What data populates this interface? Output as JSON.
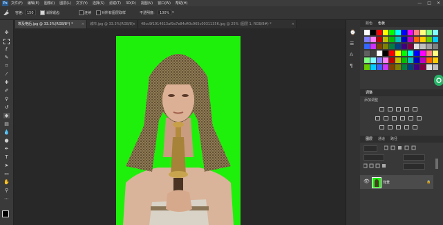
{
  "menu": {
    "logo": "Ps",
    "items": [
      "文件(F)",
      "编辑(E)",
      "图像(I)",
      "图层(L)",
      "文字(Y)",
      "选择(S)",
      "滤镜(T)",
      "3D(D)",
      "视图(V)",
      "窗口(W)",
      "帮助(H)"
    ],
    "controls": [
      "—",
      "□",
      "✕"
    ]
  },
  "options": {
    "tolerance_label": "容差:",
    "tolerance_value": "150",
    "antialias_label": "消除锯齿",
    "contiguous_label": "连续",
    "all_layers_label": "对所有图层取样",
    "opacity_label": "不透明度:",
    "opacity_value": "100%"
  },
  "tabs": [
    {
      "label": "埃及艳后.jpg @ 33.3%(RGB/8*) *",
      "close": "×"
    },
    {
      "label": "城市.jpg @ 33.3%(RGB/8)",
      "close": "×"
    },
    {
      "label": "48cc9f1914613af9a7e84d40c965c00311356.jpg @ 25% (图层 1, RGB/8#) *",
      "close": "×"
    }
  ],
  "panels": {
    "swatch_tabs": [
      "颜色",
      "色板"
    ],
    "adjust_tab": "调整",
    "adjust_label": "添加调整",
    "layers_tabs": [
      "图层",
      "通道",
      "路径"
    ],
    "layer_name": "背景",
    "swatch_colors": [
      "#ffffff",
      "#000000",
      "#ff0000",
      "#ffff00",
      "#00ff00",
      "#00ffff",
      "#0000ff",
      "#ff00ff",
      "#ff8080",
      "#ffff80",
      "#80ff80",
      "#80ffff",
      "#8080ff",
      "#ff80ff",
      "#c00000",
      "#c0c000",
      "#00c000",
      "#00c0c0",
      "#0000c0",
      "#c000c0",
      "#ff6600",
      "#ffcc00",
      "#66cc00",
      "#00ccff",
      "#3366ff",
      "#cc33ff",
      "#804000",
      "#808000",
      "#008040",
      "#004080",
      "#400080",
      "#800040",
      "#e0e0e0",
      "#c0c0c0",
      "#a0a0a0",
      "#808080",
      "#606060",
      "#404040"
    ]
  },
  "colors": {
    "chroma_green": "#1ef00b",
    "panel_bg": "#383838",
    "accent_green": "#27b469"
  }
}
